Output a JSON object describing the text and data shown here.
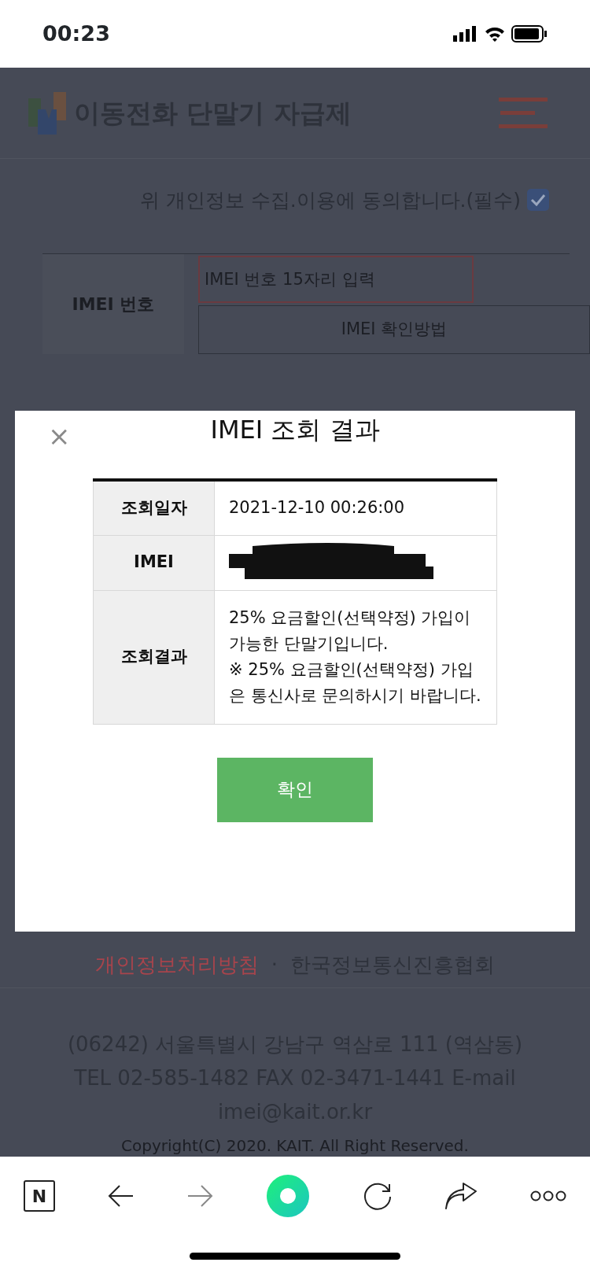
{
  "status_bar": {
    "time": "00:23"
  },
  "header": {
    "title": "이동전화 단말기 자급제"
  },
  "consent": {
    "label": "위 개인정보 수집.이용에 동의합니다.(필수)",
    "checked": true
  },
  "form": {
    "label": "IMEI 번호",
    "placeholder": "IMEI 번호 15자리 입력",
    "help_button": "IMEI 확인방법"
  },
  "modal": {
    "close": "×",
    "title": "IMEI 조회 결과",
    "rows": [
      {
        "label": "조회일자",
        "value": "2021-12-10 00:26:00",
        "redacted": false
      },
      {
        "label": "IMEI",
        "value": "",
        "redacted": true
      },
      {
        "label": "조회결과",
        "value": "25% 요금할인(선택약정) 가입이 가능한 단말기입니다.\n※ 25% 요금할인(선택약정) 가입은 통신사로 문의하시기 바랍니다.",
        "redacted": false
      }
    ],
    "confirm": "확인"
  },
  "footer": {
    "links": [
      {
        "label": "개인정보처리방침",
        "highlight": true
      },
      {
        "label": "한국정보통신진흥협회",
        "highlight": false
      }
    ],
    "separator": "·",
    "address": [
      "(06242) 서울특별시 강남구 역삼로 111 (역삼동)",
      "TEL 02-585-1482 FAX 02-3471-1441 E-mail",
      "imei@kait.or.kr"
    ],
    "copyright": "Copyright(C) 2020. KAIT. All Right Reserved."
  },
  "toolbar": {
    "home_letter": "N"
  }
}
